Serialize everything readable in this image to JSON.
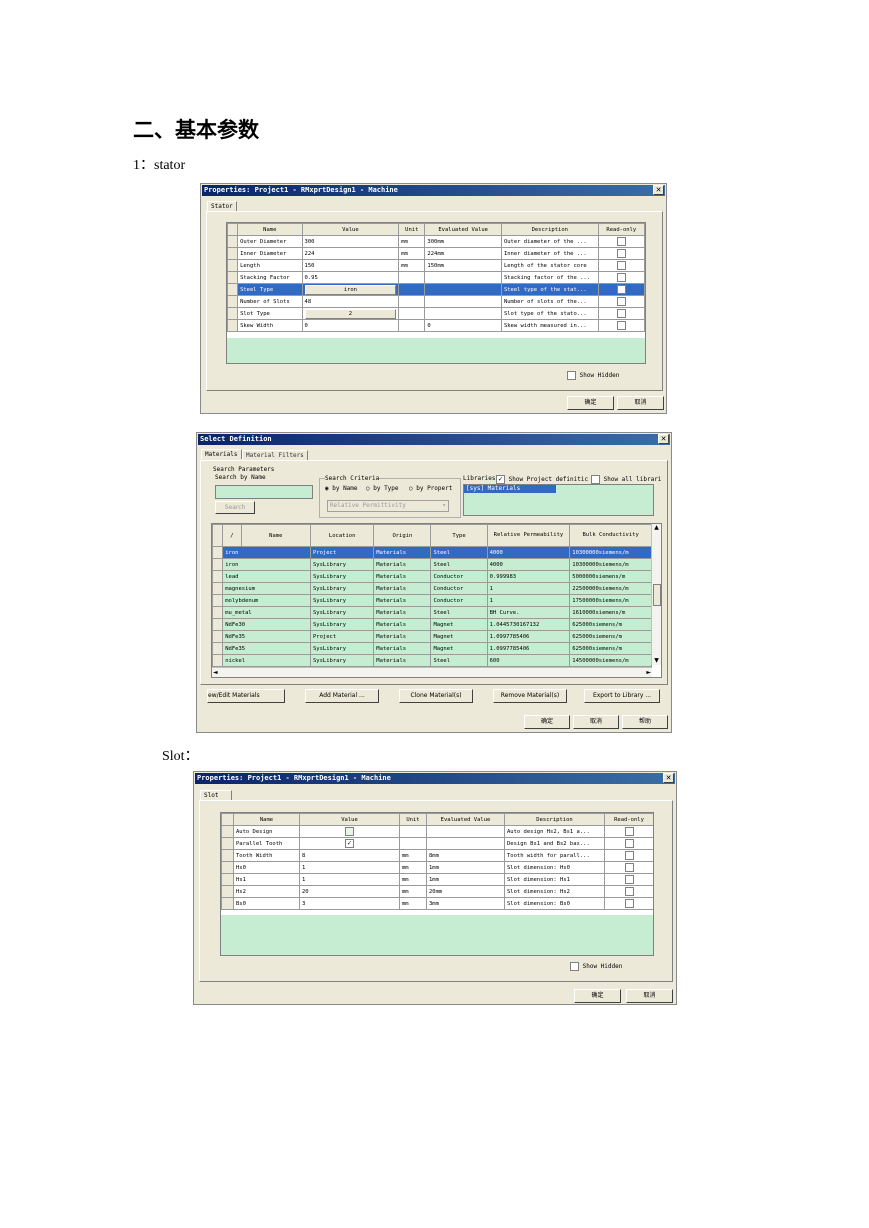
{
  "doc": {
    "heading": "二、基本参数",
    "label_stator": "1：stator",
    "label_slot": "Slot："
  },
  "stator_window": {
    "title": "Properties: Project1 - RMxprtDesign1 - Machine",
    "tab": "Stator",
    "columns": [
      "Name",
      "Value",
      "Unit",
      "Evaluated Value",
      "Description",
      "Read-only"
    ],
    "rows": [
      {
        "name": "Outer Diameter",
        "value": "300",
        "unit": "mm",
        "evaluated": "300mm",
        "description": "Outer diameter of the ..."
      },
      {
        "name": "Inner Diameter",
        "value": "224",
        "unit": "mm",
        "evaluated": "224mm",
        "description": "Inner diameter of the ..."
      },
      {
        "name": "Length",
        "value": "150",
        "unit": "mm",
        "evaluated": "150mm",
        "description": "Length of the stator core"
      },
      {
        "name": "Stacking Factor",
        "value": "0.95",
        "unit": "",
        "evaluated": "",
        "description": "Stacking factor of the ..."
      },
      {
        "name": "Steel Type",
        "value": "iron",
        "unit": "",
        "evaluated": "",
        "description": "Steel type of the stat..."
      },
      {
        "name": "Number of Slots",
        "value": "48",
        "unit": "",
        "evaluated": "",
        "description": "Number of slots of the..."
      },
      {
        "name": "Slot Type",
        "value": "2",
        "unit": "",
        "evaluated": "",
        "description": "Slot type of the stato..."
      },
      {
        "name": "Skew Width",
        "value": "0",
        "unit": "",
        "evaluated": "0",
        "description": "Skew width measured in..."
      }
    ],
    "show_hidden": "Show Hidden",
    "ok": "确定",
    "cancel": "取消"
  },
  "select_window": {
    "title": "Select Definition",
    "tab_materials": "Materials",
    "tab_filters": "Material Filters",
    "search_params": "Search Parameters",
    "search_by_name": "Search by Name",
    "search_button": "Search",
    "search_criteria": "Search Criteria",
    "by_name": "by Name",
    "by_type": "by Type",
    "by_property": "by Propert",
    "criteria_select": "Relative Permittivity",
    "libraries": "Libraries",
    "show_project": "Show Project definitic",
    "show_all": "Show all librari",
    "lib_item": "[sys] Materials",
    "columns": [
      "/",
      "Name",
      "Location",
      "Origin",
      "Type",
      "Relative Permeability",
      "Bulk Conductivity"
    ],
    "rows": [
      {
        "name": "iron",
        "location": "Project",
        "origin": "Materials",
        "type": "Steel",
        "perm": "4000",
        "cond": "10300000siemens/m"
      },
      {
        "name": "iron",
        "location": "SysLibrary",
        "origin": "Materials",
        "type": "Steel",
        "perm": "4000",
        "cond": "10300000siemens/m"
      },
      {
        "name": "lead",
        "location": "SysLibrary",
        "origin": "Materials",
        "type": "Conductor",
        "perm": "0.999983",
        "cond": "5000000siemens/m"
      },
      {
        "name": "magnesium",
        "location": "SysLibrary",
        "origin": "Materials",
        "type": "Conductor",
        "perm": "1",
        "cond": "22500000siemens/m"
      },
      {
        "name": "molybdenum",
        "location": "SysLibrary",
        "origin": "Materials",
        "type": "Conductor",
        "perm": "1",
        "cond": "17500000siemens/m"
      },
      {
        "name": "mu_metal",
        "location": "SysLibrary",
        "origin": "Materials",
        "type": "Steel",
        "perm": "BH Curve.",
        "cond": "1610000siemens/m"
      },
      {
        "name": "NdFe30",
        "location": "SysLibrary",
        "origin": "Materials",
        "type": "Magnet",
        "perm": "1.0445730167132",
        "cond": "625000siemens/m"
      },
      {
        "name": "NdFe35",
        "location": "Project",
        "origin": "Materials",
        "type": "Magnet",
        "perm": "1.0997785406",
        "cond": "625000siemens/m"
      },
      {
        "name": "NdFe35",
        "location": "SysLibrary",
        "origin": "Materials",
        "type": "Magnet",
        "perm": "1.0997785406",
        "cond": "625000siemens/m"
      },
      {
        "name": "nickel",
        "location": "SysLibrary",
        "origin": "Materials",
        "type": "Steel",
        "perm": "600",
        "cond": "14500000siemens/m"
      }
    ],
    "btn_view": "ew/Edit Materials",
    "btn_add": "Add Material ...",
    "btn_clone": "Clone Material(s)",
    "btn_remove": "Remove Material(s)",
    "btn_export": "Export to Library ...",
    "ok": "确定",
    "cancel": "取消",
    "help": "帮助"
  },
  "slot_window": {
    "title": "Properties: Project1 - RMxprtDesign1 - Machine",
    "tab": "Slot",
    "columns": [
      "Name",
      "Value",
      "Unit",
      "Evaluated Value",
      "Description",
      "Read-only"
    ],
    "rows": [
      {
        "name": "Auto Design",
        "value": "",
        "unit": "",
        "evaluated": "",
        "description": "Auto design Hs2, Bs1 a..."
      },
      {
        "name": "Parallel Tooth",
        "value": "",
        "unit": "",
        "evaluated": "",
        "description": "Design Bs1 and Bs2 bas..."
      },
      {
        "name": "Tooth Width",
        "value": "8",
        "unit": "mm",
        "evaluated": "8mm",
        "description": "Tooth width for parall..."
      },
      {
        "name": "Hs0",
        "value": "1",
        "unit": "mm",
        "evaluated": "1mm",
        "description": "Slot dimension: Hs0"
      },
      {
        "name": "Hs1",
        "value": "1",
        "unit": "mm",
        "evaluated": "1mm",
        "description": "Slot dimension: Hs1"
      },
      {
        "name": "Hs2",
        "value": "20",
        "unit": "mm",
        "evaluated": "20mm",
        "description": "Slot dimension: Hs2"
      },
      {
        "name": "Bs0",
        "value": "3",
        "unit": "mm",
        "evaluated": "3mm",
        "description": "Slot dimension: Bs0"
      }
    ],
    "show_hidden": "Show Hidden",
    "ok": "确定",
    "cancel": "取消"
  }
}
